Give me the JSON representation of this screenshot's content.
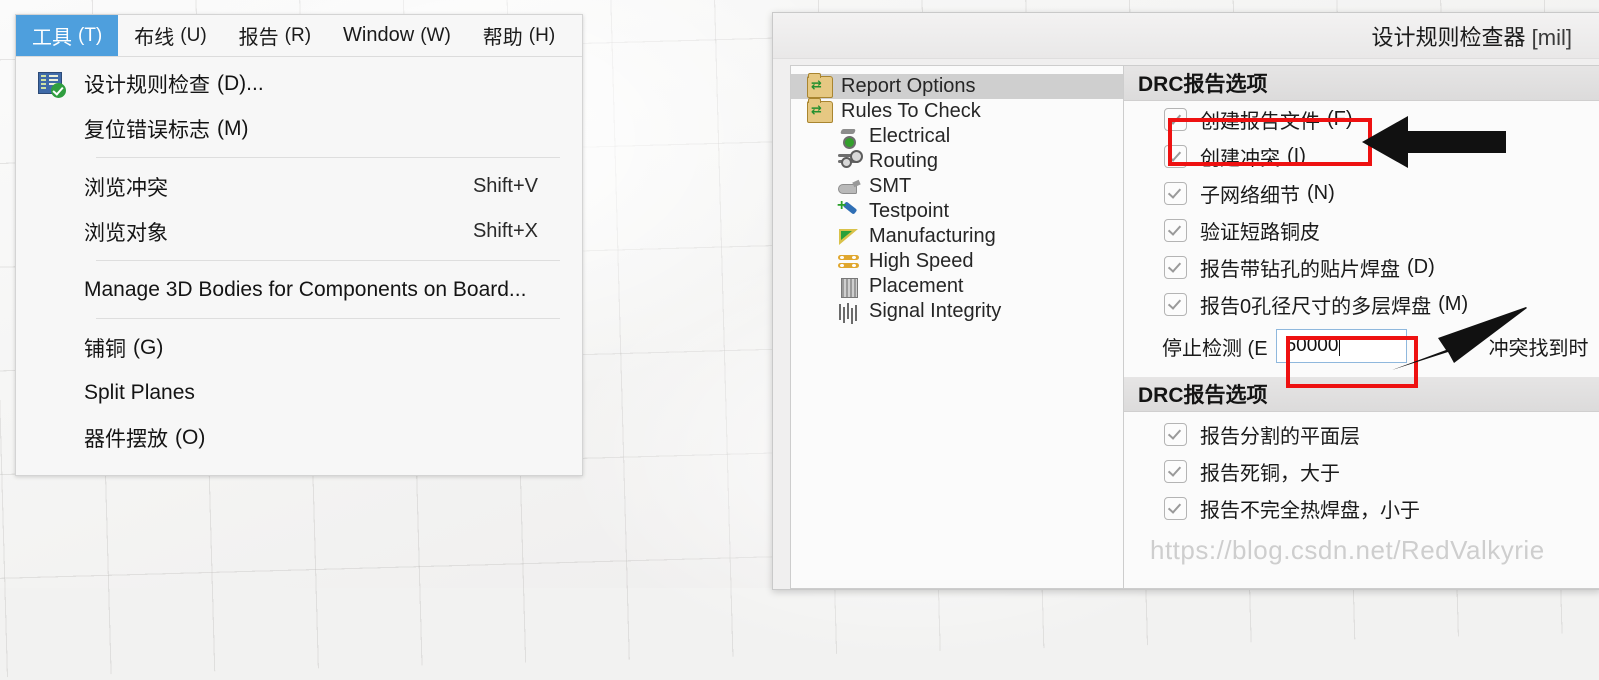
{
  "background": {
    "type": "pcb-grid-workspace"
  },
  "menu_window": {
    "menubar": [
      {
        "name": "tools",
        "label": "工具",
        "key": "(T)",
        "active": true
      },
      {
        "name": "route",
        "label": "布线",
        "key": "(U)",
        "active": false
      },
      {
        "name": "reports",
        "label": "报告",
        "key": "(R)",
        "active": false
      },
      {
        "name": "window",
        "label": "Window",
        "key": "(W)",
        "active": false
      },
      {
        "name": "help",
        "label": "帮助",
        "key": "(H)",
        "active": false
      }
    ],
    "items": [
      {
        "label": "设计规则检查",
        "key": "(D)...",
        "accel": "",
        "icon": "drc-check-icon"
      },
      {
        "label": "复位错误标志",
        "key": "(M)",
        "accel": "",
        "icon": ""
      },
      {
        "label": "浏览冲突",
        "key": "",
        "accel": "Shift+V",
        "icon": ""
      },
      {
        "label": "浏览对象",
        "key": "",
        "accel": "Shift+X",
        "icon": ""
      },
      {
        "label": "Manage 3D Bodies for Components on Board...",
        "key": "",
        "accel": "",
        "icon": ""
      },
      {
        "label": "铺铜",
        "key": "(G)",
        "accel": "",
        "icon": ""
      },
      {
        "label": "Split Planes",
        "key": "",
        "accel": "",
        "icon": ""
      },
      {
        "label": "器件摆放",
        "key": "(O)",
        "accel": "",
        "icon": ""
      }
    ]
  },
  "dialog": {
    "title": "设计规则检查器",
    "title_unit": "[mil]",
    "tree": [
      {
        "label": "Report Options",
        "icon": "folder-icon",
        "level": "root",
        "selected": true
      },
      {
        "label": "Rules To Check",
        "icon": "folder-icon",
        "level": "root",
        "selected": false
      },
      {
        "label": "Electrical",
        "icon": "electrical-icon",
        "level": "child",
        "selected": false
      },
      {
        "label": "Routing",
        "icon": "routing-icon",
        "level": "child",
        "selected": false
      },
      {
        "label": "SMT",
        "icon": "smt-icon",
        "level": "child",
        "selected": false
      },
      {
        "label": "Testpoint",
        "icon": "testpoint-icon",
        "level": "child",
        "selected": false
      },
      {
        "label": "Manufacturing",
        "icon": "manufacturing-icon",
        "level": "child",
        "selected": false
      },
      {
        "label": "High Speed",
        "icon": "high-speed-icon",
        "level": "child",
        "selected": false
      },
      {
        "label": "Placement",
        "icon": "placement-icon",
        "level": "child",
        "selected": false
      },
      {
        "label": "Signal Integrity",
        "icon": "signal-integrity-icon",
        "level": "child",
        "selected": false
      }
    ],
    "section1": {
      "header": "DRC报告选项",
      "options": [
        {
          "label": "创建报告文件",
          "key": "(F)",
          "checked": true
        },
        {
          "label": "创建冲突",
          "key": "(I)",
          "checked": true
        },
        {
          "label": "子网络细节",
          "key": "(N)",
          "checked": true
        },
        {
          "label": "验证短路铜皮",
          "key": "",
          "checked": true
        },
        {
          "label": "报告带钻孔的贴片焊盘",
          "key": "(D)",
          "checked": true
        },
        {
          "label": "报告0孔径尺寸的多层焊盘",
          "key": "(M)",
          "checked": true
        }
      ],
      "stop_row": {
        "prefix": "停止检测 (E",
        "value": "50000",
        "suffix": "冲突找到时"
      }
    },
    "section2": {
      "header": "DRC报告选项",
      "options": [
        {
          "label": "报告分割的平面层",
          "key": "",
          "checked": true
        },
        {
          "label": "报告死铜，大于",
          "key": "",
          "checked": true
        },
        {
          "label": "报告不完全热焊盘，小于",
          "key": "",
          "checked": true
        }
      ]
    }
  },
  "annotations": {
    "highlight_color": "#ee1111",
    "arrow_color": "#111111",
    "boxes": [
      "create-report-file-row",
      "stop-detection-input"
    ],
    "arrows": [
      "arrow-to-create-report-file",
      "arrow-to-stop-detection-input"
    ]
  },
  "watermark": "https://blog.csdn.net/RedValkyrie"
}
